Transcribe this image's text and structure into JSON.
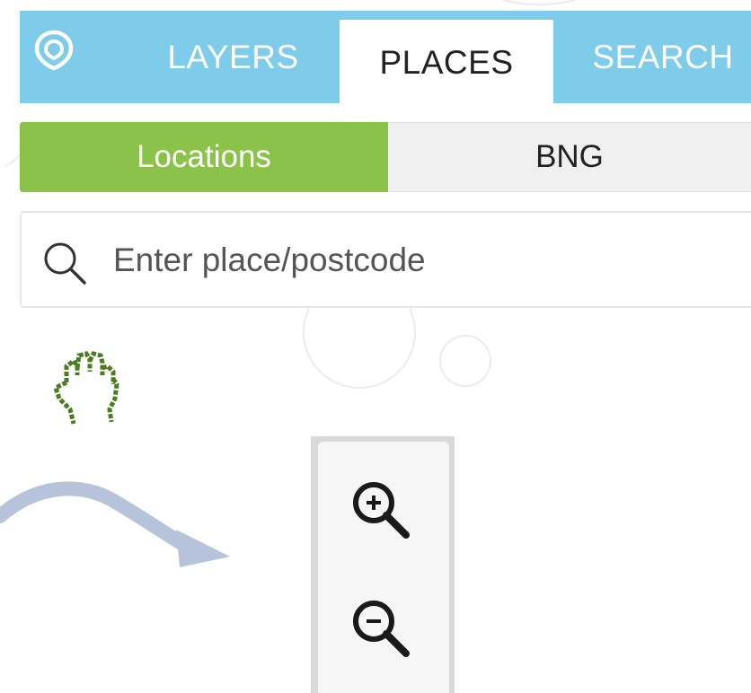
{
  "tabs": [
    {
      "label": "LAYERS",
      "active": false
    },
    {
      "label": "PLACES",
      "active": true
    },
    {
      "label": "SEARCH",
      "active": false
    }
  ],
  "segments": [
    {
      "label": "Locations",
      "active": true
    },
    {
      "label": "BNG",
      "active": false
    }
  ],
  "search": {
    "placeholder": "Enter place/postcode",
    "value": ""
  },
  "icons": {
    "logo": "location-pin-logo-icon",
    "search": "search-icon",
    "cursor": "hand-grab-cursor-icon",
    "arrow": "curved-arrow-icon",
    "zoom_in": "zoom-in-icon",
    "zoom_out": "zoom-out-icon"
  },
  "colors": {
    "tab_bar": "#7fcbea",
    "active_tab_bg": "#ffffff",
    "segment_active": "#8bc34a",
    "segment_inactive": "#f0f0f0",
    "cursor": "#4a7d1e",
    "arrow": "#b7c3da",
    "zoom_panel": "#f6f6f6"
  }
}
